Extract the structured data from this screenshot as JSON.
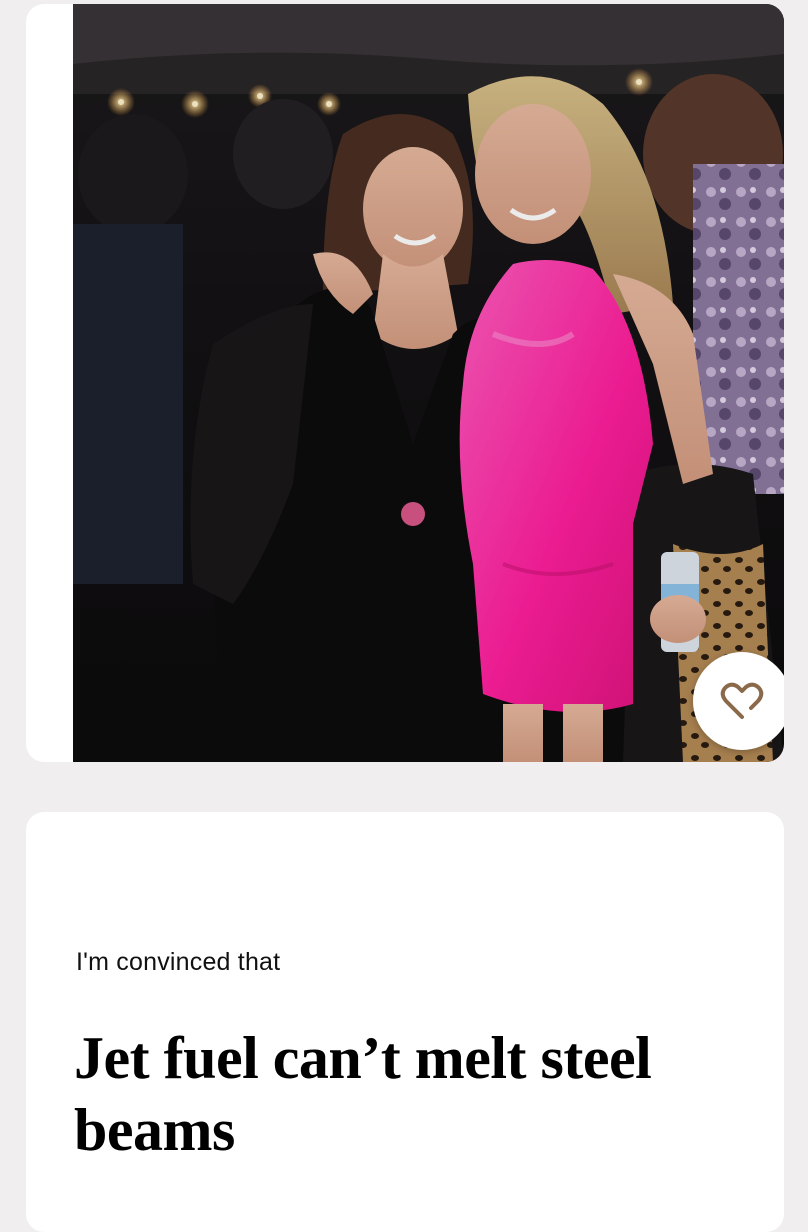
{
  "profile_photo": {
    "alt": "Two women smiling at a party"
  },
  "like_button": {
    "icon": "heart-icon"
  },
  "prompt": {
    "label": "I'm convinced that",
    "answer": "Jet fuel can’t melt steel beams"
  },
  "colors": {
    "background": "#f0eeee",
    "card": "#ffffff",
    "dress_pink": "#ff2ea8"
  }
}
